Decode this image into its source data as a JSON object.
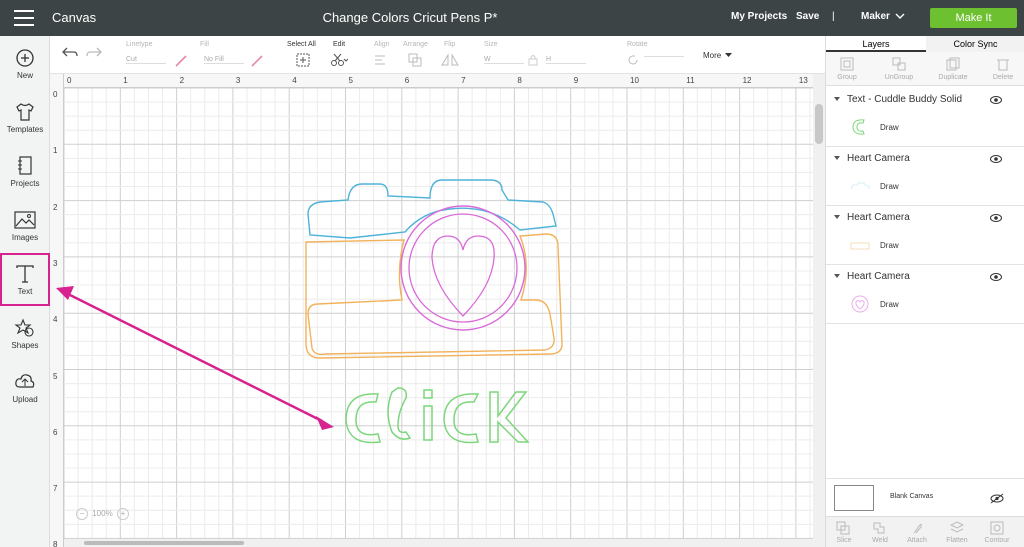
{
  "topbar": {
    "app_title": "Canvas",
    "doc_title": "Change Colors Cricut Pens P*",
    "my_projects": "My Projects",
    "save": "Save",
    "machine": "Maker",
    "make_it": "Make It"
  },
  "sidebar": {
    "items": [
      {
        "label": "New",
        "icon": "plus-circle-icon"
      },
      {
        "label": "Templates",
        "icon": "shirt-icon"
      },
      {
        "label": "Projects",
        "icon": "projects-icon"
      },
      {
        "label": "Images",
        "icon": "image-icon"
      },
      {
        "label": "Text",
        "icon": "text-icon"
      },
      {
        "label": "Shapes",
        "icon": "shapes-icon"
      },
      {
        "label": "Upload",
        "icon": "upload-icon"
      }
    ]
  },
  "toolbar": {
    "linetype_label": "Linetype",
    "linetype_value": "Cut",
    "fill_label": "Fill",
    "fill_value": "No Fill",
    "select_all": "Select All",
    "edit": "Edit",
    "align": "Align",
    "arrange": "Arrange",
    "flip": "Flip",
    "size": "Size",
    "w": "W",
    "h": "H",
    "rotate": "Rotate",
    "more": "More"
  },
  "ruler": {
    "top": [
      "0",
      "1",
      "2",
      "3",
      "4",
      "5",
      "6",
      "7",
      "8",
      "9",
      "10",
      "11",
      "12",
      "13"
    ],
    "left": [
      "0",
      "1",
      "2",
      "3",
      "4",
      "5",
      "6",
      "7",
      "8"
    ]
  },
  "canvas": {
    "zoom": "100%",
    "text_design": "ClICK"
  },
  "panel": {
    "tab_layers": "Layers",
    "tab_color_sync": "Color Sync",
    "actions": [
      "Group",
      "UnGroup",
      "Duplicate",
      "Delete"
    ],
    "layers": [
      {
        "name": "Text - Cuddle Buddy Solid",
        "op": "Draw",
        "color": "#7bd67b"
      },
      {
        "name": "Heart Camera",
        "op": "Draw",
        "color": "#66bfe0"
      },
      {
        "name": "Heart Camera",
        "op": "Draw",
        "color": "#f2b25c"
      },
      {
        "name": "Heart Camera",
        "op": "Draw",
        "color": "#d96ad9"
      }
    ],
    "blank_canvas": "Blank Canvas",
    "bottom": [
      "Slice",
      "Weld",
      "Attach",
      "Flatten",
      "Contour"
    ]
  },
  "colors": {
    "topbar": "#3d4446",
    "make_it": "#6dc02f",
    "highlight": "#d6238f",
    "camera_top": "#4fb3d9",
    "camera_body": "#f2b25c",
    "lens": "#d96ad9",
    "text": "#7bd67b"
  }
}
